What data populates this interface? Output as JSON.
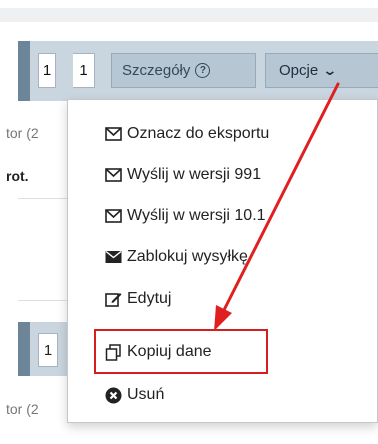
{
  "toolbar": {
    "page_a": "1",
    "page_b": "1",
    "details_label": "Szczegóły",
    "options_label": "Opcje"
  },
  "background": {
    "row1_fragment": "tor (2",
    "row1_bold": "rot.",
    "row2_page": "1",
    "row2_fragment": "tor (2"
  },
  "menu": {
    "items": [
      {
        "label": "Oznacz do eksportu",
        "icon": "envelope-outline-icon"
      },
      {
        "label": "Wyślij w wersji 991",
        "icon": "envelope-outline-icon"
      },
      {
        "label": "Wyślij w wersji 10.1",
        "icon": "envelope-outline-icon"
      },
      {
        "label": "Zablokuj wysyłkę",
        "icon": "envelope-solid-icon"
      },
      {
        "label": "Edytuj",
        "icon": "edit-icon"
      },
      {
        "label": "Kopiuj dane",
        "icon": "copy-icon"
      },
      {
        "label": "Usuń",
        "icon": "delete-circle-icon"
      }
    ]
  },
  "colors": {
    "toolbar_bg": "#c9d5df",
    "button_bg": "#b6c7d3",
    "highlight": "#d21f1f",
    "arrow": "#e02020"
  }
}
